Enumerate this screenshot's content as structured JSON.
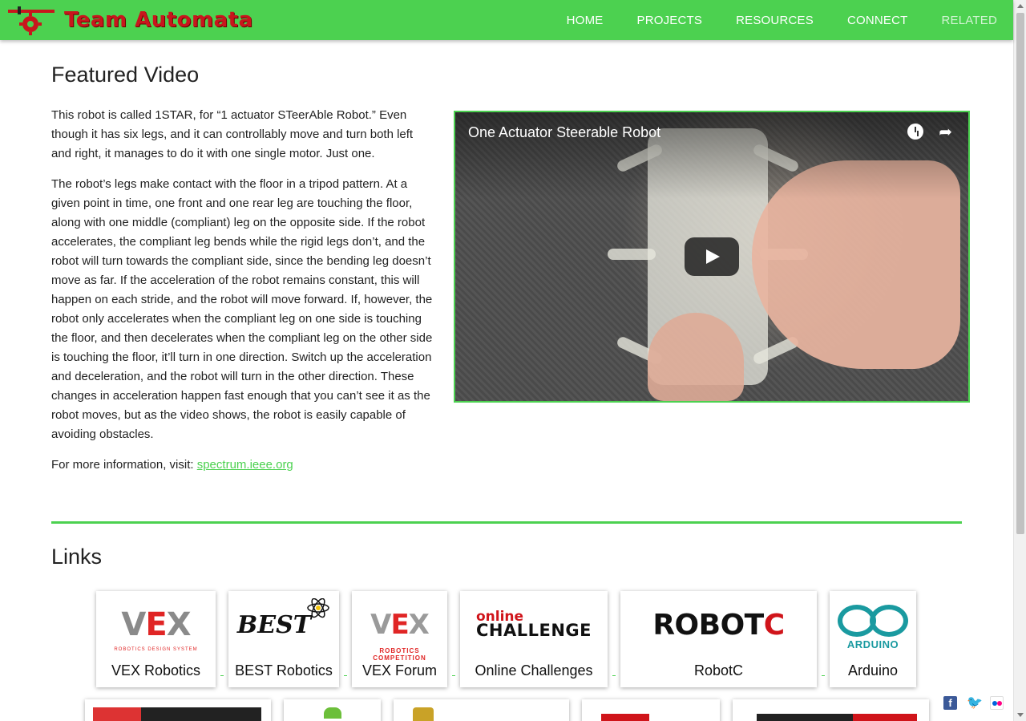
{
  "header": {
    "site_name": "Team Automata",
    "nav": [
      "HOME",
      "PROJECTS",
      "RESOURCES",
      "CONNECT",
      "RELATED"
    ]
  },
  "featured": {
    "title": "Featured Video",
    "video_title": "One Actuator Steerable Robot",
    "paragraphs": [
      "This robot is called 1STAR, for “1 actuator STeerAble Robot.” Even though it has six legs, and it can controllably move and turn both left and right, it manages to do it with one single motor. Just one.",
      "The robot’s legs make contact with the floor in a tripod pattern. At a given point in time, one front and one rear leg are touching the floor, along with one middle (compliant) leg on the opposite side. If the robot accelerates, the compliant leg bends while the rigid legs don’t, and the robot will turn towards the compliant side, since the bending leg doesn’t move as far. If the acceleration of the robot remains constant, this will happen on each stride, and the robot will move forward. If, however, the robot only accelerates when the compliant leg on one side is touching the floor, and then decelerates when the compliant leg on the other side is touching the floor, it’ll turn in one direction. Switch up the acceleration and deceleration, and the robot will turn in the other direction. These changes in acceleration happen fast enough that you can’t see it as the robot moves, but as the video shows, the robot is easily capable of avoiding obstacles."
    ],
    "more_info_prefix": "For more information, visit: ",
    "more_info_link": "spectrum.ieee.org"
  },
  "links": {
    "title": "Links",
    "cards": [
      {
        "label": "VEX Robotics",
        "logo": "VEX",
        "logo_sub": "ROBOTICS DESIGN SYSTEM"
      },
      {
        "label": "BEST Robotics",
        "logo": "BEST"
      },
      {
        "label": "VEX Forum",
        "logo": "VEX",
        "logo_sub": "ROBOTICS COMPETITION"
      },
      {
        "label": "Online Challenges",
        "logo_top": "online",
        "logo_bottom": "CHALLENGE"
      },
      {
        "label": "RobotC",
        "logo": "ROBOT",
        "logo_accent": "C"
      },
      {
        "label": "Arduino",
        "logo": "ARDUINO"
      }
    ]
  },
  "colors": {
    "accent": "#4cd150",
    "brand_red": "#c8161d"
  },
  "social": [
    "facebook-icon",
    "twitter-icon",
    "flickr-icon"
  ]
}
